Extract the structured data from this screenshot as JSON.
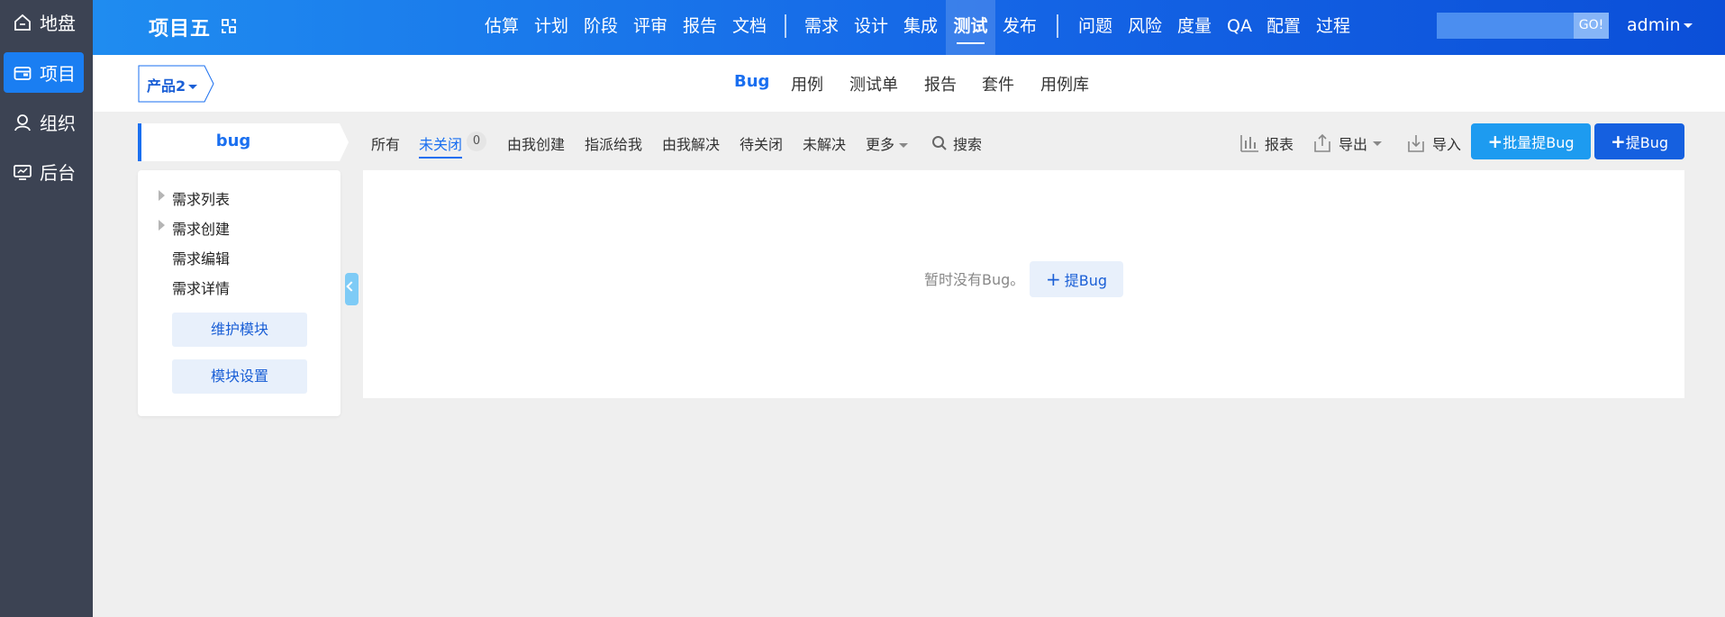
{
  "rail": {
    "items": [
      {
        "label": "地盘",
        "icon": "home-icon"
      },
      {
        "label": "项目",
        "icon": "project-icon",
        "active": true
      },
      {
        "label": "组织",
        "icon": "user-icon"
      },
      {
        "label": "后台",
        "icon": "monitor-icon"
      }
    ]
  },
  "header": {
    "project_title": "项目五",
    "nav": [
      "估算",
      "计划",
      "阶段",
      "评审",
      "报告",
      "文档",
      "需求",
      "设计",
      "集成",
      "测试",
      "发布",
      "问题",
      "风险",
      "度量",
      "QA",
      "配置",
      "过程"
    ],
    "active_nav": "测试",
    "search_go": "GO!",
    "search_value": "",
    "user": "admin"
  },
  "subnav": {
    "product": "产品2",
    "items": [
      "Bug",
      "用例",
      "测试单",
      "报告",
      "套件",
      "用例库"
    ],
    "active": "Bug"
  },
  "module": {
    "title": "bug",
    "tree": [
      "需求列表",
      "需求创建",
      "需求编辑",
      "需求详情"
    ],
    "maintain_button": "维护模块",
    "settings_button": "模块设置"
  },
  "filters": {
    "items": [
      "所有",
      "未关闭",
      "由我创建",
      "指派给我",
      "由我解决",
      "待关闭",
      "未解决",
      "更多",
      "搜索"
    ],
    "active": "未关闭",
    "active_count": "0"
  },
  "tools": {
    "report": "报表",
    "export": "导出",
    "import": "导入",
    "batch_create": "批量提Bug",
    "create": "提Bug"
  },
  "content": {
    "empty_text": "暂时没有Bug。",
    "empty_button": "提Bug"
  },
  "colors": {
    "rail_bg": "#3c4353",
    "accent": "#1a6ff0",
    "batch_button": "#1d9bf0",
    "create_button": "#1560e0"
  }
}
